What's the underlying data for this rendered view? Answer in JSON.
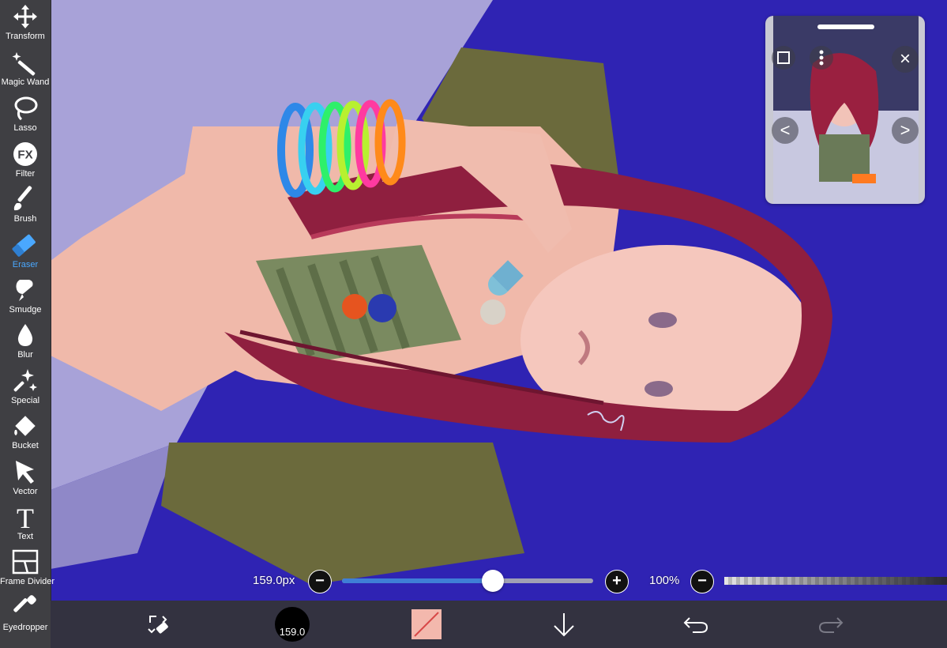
{
  "toolbar": {
    "items": [
      {
        "label": "Transform",
        "icon": "move-arrows-icon"
      },
      {
        "label": "Magic Wand",
        "icon": "magic-wand-icon"
      },
      {
        "label": "Lasso",
        "icon": "lasso-icon"
      },
      {
        "label": "Filter",
        "icon": "fx-icon",
        "glyph": "FX"
      },
      {
        "label": "Brush",
        "icon": "brush-icon"
      },
      {
        "label": "Eraser",
        "icon": "eraser-icon",
        "active": true
      },
      {
        "label": "Smudge",
        "icon": "smudge-icon"
      },
      {
        "label": "Blur",
        "icon": "drop-icon"
      },
      {
        "label": "Special",
        "icon": "sparkle-icon"
      },
      {
        "label": "Bucket",
        "icon": "bucket-icon"
      },
      {
        "label": "Vector",
        "icon": "cursor-arrow-icon"
      },
      {
        "label": "Text",
        "icon": "text-T-icon",
        "glyph": "T"
      },
      {
        "label": "Frame Divider",
        "icon": "frame-divider-icon"
      },
      {
        "label": "Eyedropper",
        "icon": "eyedropper-icon"
      }
    ],
    "active_color": "#4aa8ff"
  },
  "brush": {
    "size_label": "159.0px",
    "size_fraction": 0.6,
    "opacity_label": "100%",
    "opacity_fraction": 1.0,
    "minus_glyph": "−",
    "plus_glyph": "+"
  },
  "bottom_bar": {
    "brush_size_badge": "159.0",
    "primary_color": "#f3b8ad"
  },
  "reference_window": {
    "prev_glyph": "<",
    "next_glyph": ">",
    "close_glyph": "×"
  },
  "colors": {
    "toolbar_bg": "#3f3f43",
    "canvas_bg": "#2a1fa8",
    "slider_fill": "#3f7fd6"
  }
}
